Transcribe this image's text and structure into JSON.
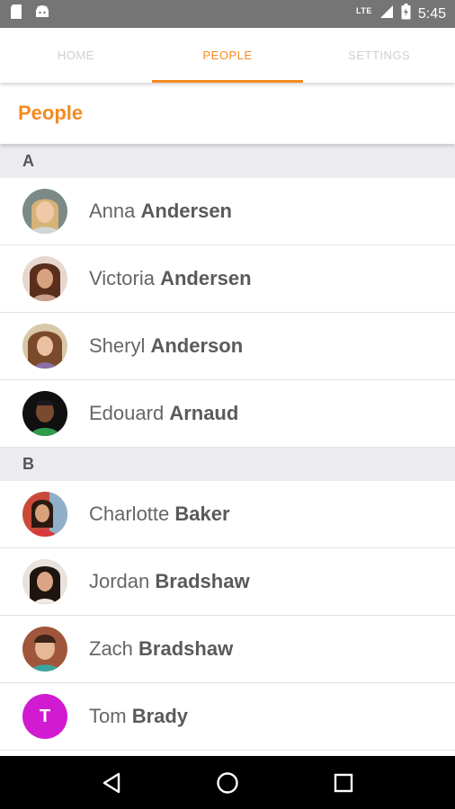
{
  "status_bar": {
    "time": "5:45",
    "network": "LTE",
    "icons": [
      "sd-card-icon",
      "android-icon",
      "signal-icon",
      "battery-icon"
    ]
  },
  "tabs": [
    {
      "label": "HOME",
      "active": false
    },
    {
      "label": "PEOPLE",
      "active": true
    },
    {
      "label": "SETTINGS",
      "active": false
    }
  ],
  "page": {
    "title": "People"
  },
  "sections": [
    {
      "letter": "A",
      "people": [
        {
          "first": "Anna",
          "last": "Andersen",
          "avatar": "photo"
        },
        {
          "first": "Victoria",
          "last": "Andersen",
          "avatar": "photo"
        },
        {
          "first": "Sheryl",
          "last": "Anderson",
          "avatar": "photo"
        },
        {
          "first": "Edouard",
          "last": "Arnaud",
          "avatar": "photo"
        }
      ]
    },
    {
      "letter": "B",
      "people": [
        {
          "first": "Charlotte",
          "last": "Baker",
          "avatar": "photo"
        },
        {
          "first": "Jordan",
          "last": "Bradshaw",
          "avatar": "photo"
        },
        {
          "first": "Zach",
          "last": "Bradshaw",
          "avatar": "photo"
        },
        {
          "first": "Tom",
          "last": "Brady",
          "avatar": "initial",
          "initial": "T"
        }
      ]
    }
  ],
  "colors": {
    "accent": "#f58a1f",
    "initial_avatar_bg": "#d11bd1",
    "status_bar_bg": "#757575",
    "section_header_bg": "#ececf0"
  },
  "nav_bar": [
    "back-icon",
    "home-icon",
    "recents-icon"
  ]
}
